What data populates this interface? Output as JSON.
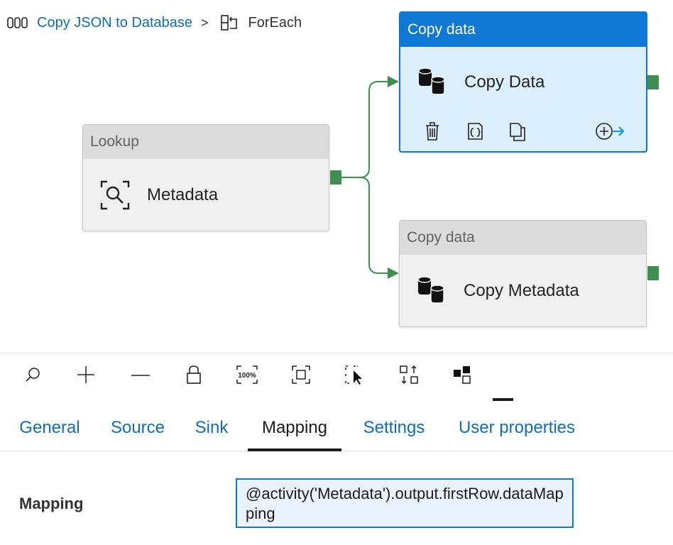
{
  "breadcrumb": {
    "pipeline_icon": "pipeline-icon",
    "pipeline_name": "Copy JSON to Database",
    "separator": ">",
    "foreach_icon": "foreach-icon",
    "current": "ForEach"
  },
  "canvas": {
    "nodes": {
      "lookup": {
        "type_label": "Lookup",
        "name": "Metadata",
        "icon": "lookup-icon"
      },
      "copy_data": {
        "type_label": "Copy data",
        "name": "Copy Data",
        "icon": "database-icon",
        "selected": true
      },
      "copy_metadata": {
        "type_label": "Copy data",
        "name": "Copy Metadata",
        "icon": "database-icon"
      }
    },
    "node_actions": [
      "delete-icon",
      "code-icon",
      "clone-icon",
      "add-output-icon"
    ],
    "colors": {
      "accent": "#0f78d4",
      "selected_fill": "#dcefff",
      "edge": "#3e8e4f"
    }
  },
  "toolbar": {
    "tools": [
      "search-icon",
      "zoom-in-icon",
      "zoom-out-icon",
      "lock-icon",
      "zoom-100-icon",
      "fit-to-screen-icon",
      "select-icon",
      "auto-align-icon",
      "layout-icon"
    ],
    "zoom_label": "100%"
  },
  "tabs": [
    {
      "label": "General"
    },
    {
      "label": "Source"
    },
    {
      "label": "Sink"
    },
    {
      "label": "Mapping",
      "active": true
    },
    {
      "label": "Settings"
    },
    {
      "label": "User properties"
    }
  ],
  "mapping": {
    "label": "Mapping",
    "expression": "@activity('Metadata').output.firstRow.dataMapping"
  }
}
